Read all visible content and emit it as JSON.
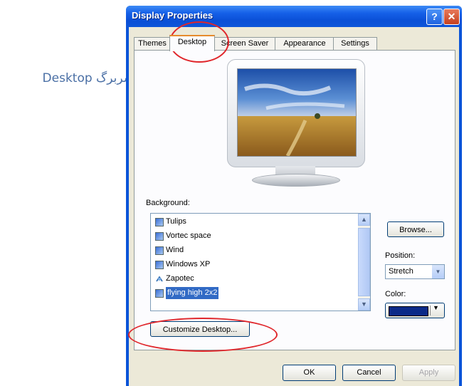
{
  "annotation": {
    "label": "سربرگ Desktop"
  },
  "window": {
    "title": "Display Properties",
    "help_label": "?",
    "close_label": "✕",
    "tabs": [
      {
        "label": "Themes",
        "active": false
      },
      {
        "label": "Desktop",
        "active": true
      },
      {
        "label": "Screen Saver",
        "active": false
      },
      {
        "label": "Appearance",
        "active": false
      },
      {
        "label": "Settings",
        "active": false
      }
    ]
  },
  "desktop_tab": {
    "background_label": "Background:",
    "background_items": [
      {
        "name": "Tulips",
        "icon": "bitmap-icon"
      },
      {
        "name": "Vortec space",
        "icon": "bitmap-icon"
      },
      {
        "name": "Wind",
        "icon": "bitmap-icon"
      },
      {
        "name": "Windows XP",
        "icon": "bitmap-icon"
      },
      {
        "name": "Zapotec",
        "icon": "html-icon"
      },
      {
        "name": "flying high 2x2",
        "icon": "bitmap-icon",
        "selected": true
      }
    ],
    "browse_label": "Browse...",
    "position_label": "Position:",
    "position_value": "Stretch",
    "color_label": "Color:",
    "color_value": "#0b2a88",
    "customize_label": "Customize Desktop..."
  },
  "buttons": {
    "ok": "OK",
    "cancel": "Cancel",
    "apply": "Apply"
  },
  "colors": {
    "titlebar": "#0a54d8",
    "highlight": "#e0262b",
    "selection": "#316ac5"
  }
}
